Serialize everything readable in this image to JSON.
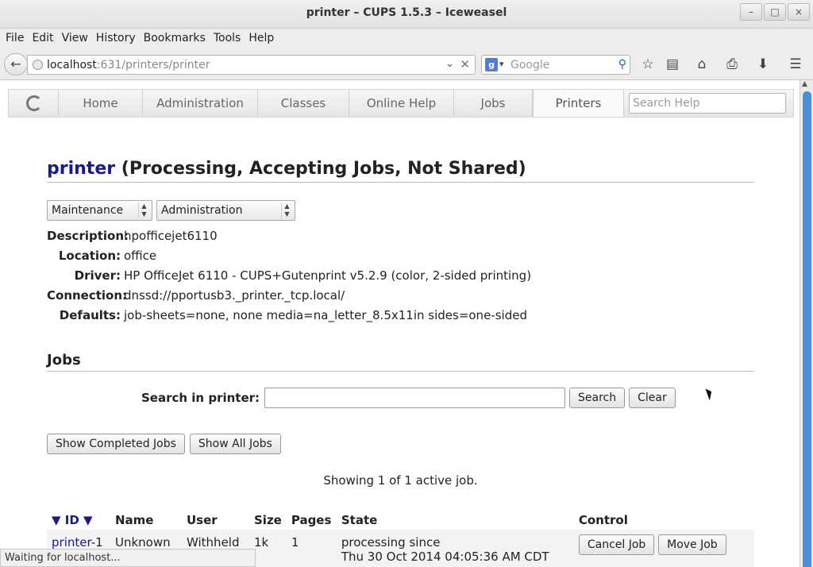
{
  "window": {
    "title": "printer – CUPS 1.5.3 – Iceweasel",
    "buttons": [
      "–",
      "□",
      "×"
    ]
  },
  "menu": [
    "File",
    "Edit",
    "View",
    "History",
    "Bookmarks",
    "Tools",
    "Help"
  ],
  "toolbar": {
    "back_icon": "←",
    "url_host": "localhost",
    "url_rest": ":631/printers/printer",
    "search_engine": "g",
    "search_placeholder": "Google",
    "icons": [
      "star-icon",
      "reading-list-icon",
      "home-icon",
      "print-icon",
      "download-icon",
      "menu-icon"
    ]
  },
  "cups_nav": {
    "tabs": [
      "Home",
      "Administration",
      "Classes",
      "Online Help",
      "Jobs",
      "Printers"
    ],
    "active": "Printers",
    "search_placeholder": "Search Help"
  },
  "printer": {
    "name": "printer",
    "status": "(Processing, Accepting Jobs, Not Shared)",
    "maintenance_select": "Maintenance",
    "administration_select": "Administration",
    "properties": [
      {
        "label": "Description:",
        "value": "hpofficejet6110"
      },
      {
        "label": "Location:",
        "value": "office"
      },
      {
        "label": "Driver:",
        "value": "HP OfficeJet 6110 - CUPS+Gutenprint v5.2.9 (color, 2-sided printing)"
      },
      {
        "label": "Connection:",
        "value": "dnssd://pportusb3._printer._tcp.local/"
      },
      {
        "label": "Defaults:",
        "value": "job-sheets=none, none media=na_letter_8.5x11in sides=one-sided"
      }
    ]
  },
  "jobs": {
    "heading": "Jobs",
    "search_label": "Search in printer:",
    "search_button": "Search",
    "clear_button": "Clear",
    "show_completed": "Show Completed Jobs",
    "show_all": "Show All Jobs",
    "showing": "Showing 1 of 1 active job.",
    "columns": [
      "▼ ID ▼",
      "Name",
      "User",
      "Size",
      "Pages",
      "State",
      "Control"
    ],
    "rows": [
      {
        "id_link": "printer",
        "id_suffix": "-1",
        "name": "Unknown",
        "user": "Withheld",
        "size": "1k",
        "pages": "1",
        "state_line1": "processing since",
        "state_line2": "Thu 30 Oct 2014 04:05:36 AM CDT",
        "cancel": "Cancel Job",
        "move": "Move Job"
      }
    ]
  },
  "status_bar": "Waiting for localhost..."
}
